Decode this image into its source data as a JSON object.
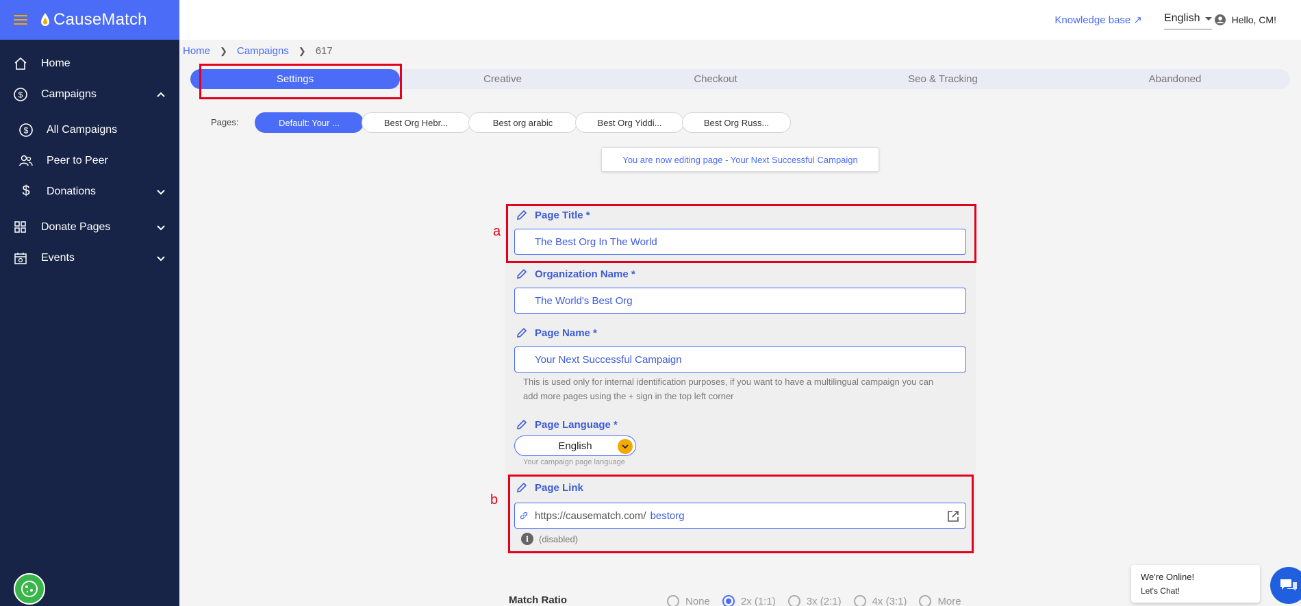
{
  "brand": {
    "name": "CauseMatch"
  },
  "sidebar": {
    "items": [
      {
        "label": "Home"
      },
      {
        "label": "Campaigns"
      },
      {
        "label": "All Campaigns"
      },
      {
        "label": "Peer to Peer"
      },
      {
        "label": "Donations"
      },
      {
        "label": "Donate Pages"
      },
      {
        "label": "Events"
      }
    ]
  },
  "topbar": {
    "knowledge_base": "Knowledge base ↗",
    "language": "English",
    "greeting": "Hello, CM!"
  },
  "breadcrumb": {
    "home": "Home",
    "campaigns": "Campaigns",
    "current": "617"
  },
  "tabs": [
    "Settings",
    "Creative",
    "Checkout",
    "Seo & Tracking",
    "Abandoned"
  ],
  "pages": {
    "label": "Pages:",
    "items": [
      "Default: Your ...",
      "Best Org Hebr...",
      "Best org arabic",
      "Best Org Yiddi...",
      "Best Org Russ..."
    ]
  },
  "editing_banner": "You are now editing page - Your Next Successful Campaign",
  "form": {
    "page_title": {
      "label": "Page Title *",
      "value": "The Best Org In The World"
    },
    "org_name": {
      "label": "Organization Name *",
      "value": "The World's Best Org"
    },
    "page_name": {
      "label": "Page Name *",
      "value": "Your Next Successful Campaign",
      "help_line1": "This is used only for internal identification purposes, if you want to have a multilingual campaign you can",
      "help_line2": "add more pages using the + sign in the top left corner"
    },
    "page_language": {
      "label": "Page Language *",
      "value": "English",
      "hint": "Your campaign page language"
    },
    "page_link": {
      "label": "Page Link",
      "prefix": "https://causematch.com/",
      "slug": "bestorg",
      "note": "(disabled)"
    }
  },
  "annotations": {
    "a": "a",
    "b": "b"
  },
  "match_ratio": {
    "label": "Match Ratio",
    "options": [
      "None",
      "2x (1:1)",
      "3x (2:1)",
      "4x (3:1)",
      "More"
    ],
    "selected": "2x (1:1)"
  },
  "chat": {
    "line1": "We're Online!",
    "line2": "Let's Chat!"
  },
  "colors": {
    "primary": "#4a6cf7",
    "sidebar": "#172447",
    "accent": "#f2a900",
    "annotation": "#e3001b"
  }
}
